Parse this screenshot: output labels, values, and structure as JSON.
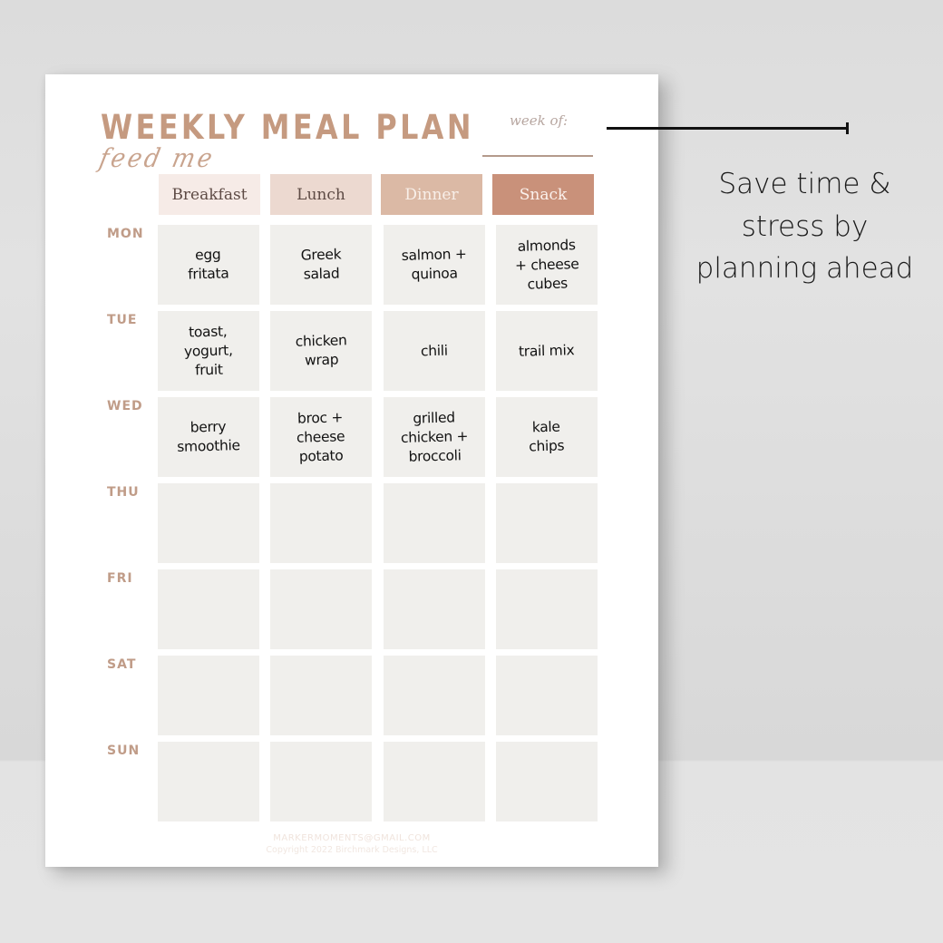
{
  "planner": {
    "title": "WEEKLY MEAL PLAN",
    "subtitle_script": "feed me",
    "week_of_label": "week of:",
    "week_of_value": "",
    "columns": [
      {
        "label": "Breakfast",
        "bg": "#f6ebe7",
        "color": "#5e4b45"
      },
      {
        "label": "Lunch",
        "bg": "#ecd9d0",
        "color": "#5e4b45"
      },
      {
        "label": "Dinner",
        "bg": "#dbb9a5",
        "color": "#f8efe9"
      },
      {
        "label": "Snack",
        "bg": "#c9917a",
        "color": "#fbf1ec"
      }
    ],
    "days": [
      {
        "label": "MON",
        "meals": [
          "egg\nfritata",
          "Greek\nsalad",
          "salmon +\nquinoa",
          "almonds\n+ cheese\ncubes"
        ]
      },
      {
        "label": "TUE",
        "meals": [
          "toast,\nyogurt,\nfruit",
          "chicken\nwrap",
          "chili",
          "trail mix"
        ]
      },
      {
        "label": "WED",
        "meals": [
          "berry\nsmoothie",
          "broc +\ncheese\npotato",
          "grilled\nchicken +\nbroccoli",
          "kale\nchips"
        ]
      },
      {
        "label": "THU",
        "meals": [
          "",
          "",
          "",
          ""
        ]
      },
      {
        "label": "FRI",
        "meals": [
          "",
          "",
          "",
          ""
        ]
      },
      {
        "label": "SAT",
        "meals": [
          "",
          "",
          "",
          ""
        ]
      },
      {
        "label": "SUN",
        "meals": [
          "",
          "",
          "",
          ""
        ]
      }
    ],
    "footer_email": "MARKERMOMENTS@GMAIL.COM",
    "footer_copyright": "Copyright 2022 Birchmark Designs, LLC"
  },
  "callout": {
    "text": "Save time & stress by planning ahead"
  },
  "colors": {
    "accent": "#c59a80",
    "cell_bg": "#f0efec"
  }
}
